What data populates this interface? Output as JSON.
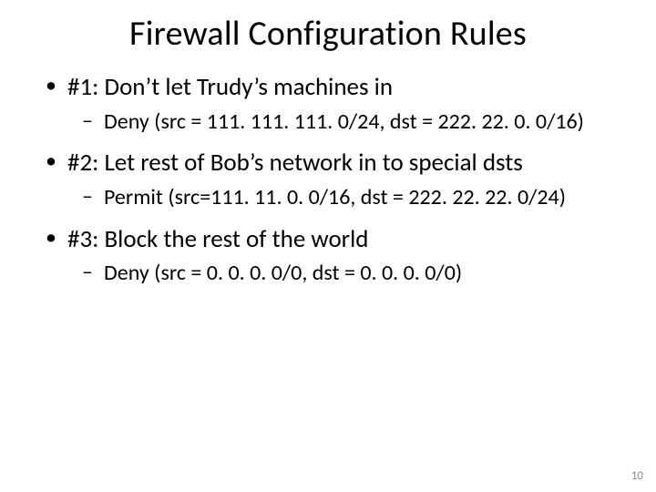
{
  "title": "Firewall Configuration Rules",
  "bullets": [
    {
      "text": "#1: Don’t let Trudy’s machines in",
      "sub": [
        "Deny (src = 111. 111. 111. 0/24, dst = 222. 22. 0. 0/16)"
      ]
    },
    {
      "text": "#2: Let rest of Bob’s network in to special dsts",
      "sub": [
        "Permit (src=111. 11. 0. 0/16, dst = 222. 22. 22. 0/24)"
      ]
    },
    {
      "text": "#3: Block the rest of the world",
      "sub": [
        "Deny (src = 0. 0. 0. 0/0, dst = 0. 0. 0. 0/0)"
      ]
    }
  ],
  "page_number": "10"
}
